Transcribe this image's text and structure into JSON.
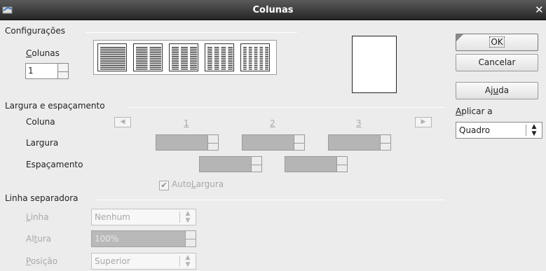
{
  "window": {
    "title": "Colunas"
  },
  "settings": {
    "header": "Configurações",
    "columns_label_pre": "",
    "columns_label_u": "C",
    "columns_label_post": "olunas",
    "columns_value": "1",
    "preset_counts": [
      1,
      2,
      3,
      4,
      5
    ]
  },
  "buttons": {
    "ok": "OK",
    "cancel": "Cancelar",
    "help_pre": "Aj",
    "help_u": "u",
    "help_post": "da"
  },
  "apply_to": {
    "label_u": "A",
    "label_post": "plicar a",
    "value": "Quadro"
  },
  "width_spacing": {
    "header": "Largura e espaçamento",
    "column_label": "Coluna",
    "col_numbers": [
      "1",
      "2",
      "3"
    ],
    "width_label": "Largura",
    "spacing_label": "Espaçamento",
    "autowidth_pre": "Auto",
    "autowidth_u": "L",
    "autowidth_post": "argura",
    "autowidth_checked": true
  },
  "separator": {
    "header": "Linha separadora",
    "line_label_u": "L",
    "line_label_post": "inha",
    "line_value": "Nenhum",
    "height_label_pre": "Al",
    "height_label_u": "t",
    "height_label_post": "ura",
    "height_value": "100%",
    "position_label_u": "P",
    "position_label_post": "osição",
    "position_value": "Superior"
  }
}
